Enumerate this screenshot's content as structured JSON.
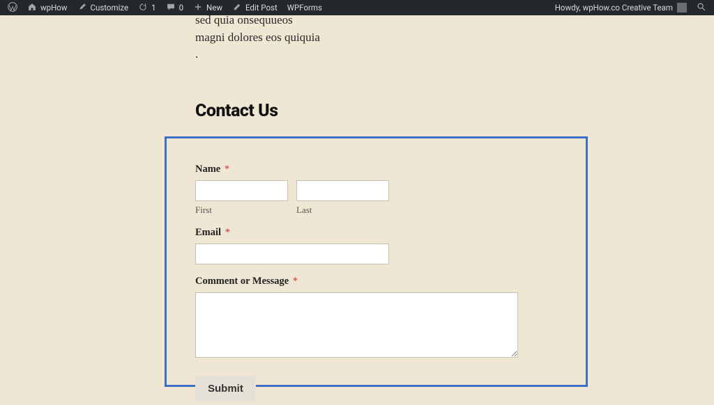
{
  "adminbar": {
    "site_name": "wpHow",
    "customize": "Customize",
    "updates_count": "1",
    "comments_count": "0",
    "new": "New",
    "edit_post": "Edit Post",
    "wpforms": "WPForms",
    "howdy": "Howdy, wpHow.co Creative Team"
  },
  "page": {
    "body_excerpt": "sed quia onsequueos magni dolores eos quiquia .",
    "heading": "Contact Us",
    "cutoff": ""
  },
  "form": {
    "name_label": "Name",
    "first_sub": "First",
    "last_sub": "Last",
    "email_label": "Email",
    "message_label": "Comment or Message",
    "required_mark": "*",
    "submit_label": "Submit",
    "values": {
      "first": "",
      "last": "",
      "email": "",
      "message": ""
    }
  }
}
